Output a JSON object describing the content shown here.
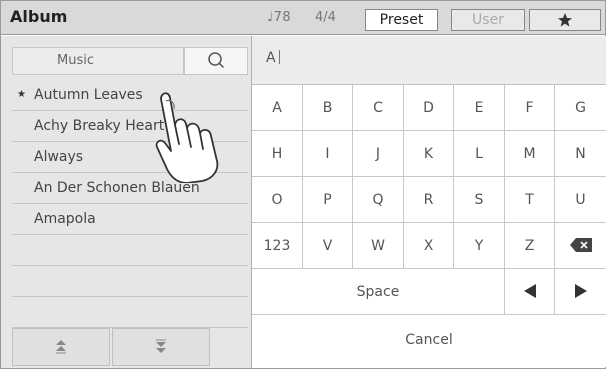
{
  "header": {
    "title": "Album",
    "tempo": "♩78",
    "time_signature": "4/4",
    "tabs": [
      {
        "label": "Preset",
        "active": true
      },
      {
        "label": "User",
        "active": false
      }
    ],
    "favorite_icon": "star-icon"
  },
  "search": {
    "label": "Music",
    "icon": "search-icon"
  },
  "songs": [
    {
      "title": "Autumn Leaves",
      "favorite": true
    },
    {
      "title": "Achy Breaky Heart",
      "favorite": false
    },
    {
      "title": "Always",
      "favorite": false
    },
    {
      "title": "An Der Schonen Blauen",
      "favorite": false
    },
    {
      "title": "Amapola",
      "favorite": false
    },
    {
      "title": "",
      "favorite": false
    },
    {
      "title": "",
      "favorite": false
    },
    {
      "title": "",
      "favorite": false
    }
  ],
  "paging": {
    "up_icon": "double-chevron-up-icon",
    "down_icon": "double-chevron-down-icon"
  },
  "keyboard": {
    "input_value": "A",
    "rows": [
      [
        "A",
        "B",
        "C",
        "D",
        "E",
        "F",
        "G"
      ],
      [
        "H",
        "I",
        "J",
        "K",
        "L",
        "M",
        "N"
      ],
      [
        "O",
        "P",
        "Q",
        "R",
        "S",
        "T",
        "U"
      ],
      [
        "123",
        "V",
        "W",
        "X",
        "Y",
        "Z"
      ]
    ],
    "backspace_icon": "backspace-icon",
    "space_label": "Space",
    "left_icon": "arrow-left-icon",
    "right_icon": "arrow-right-icon",
    "cancel_label": "Cancel"
  },
  "colors": {
    "header_bg": "#d9d9d9",
    "panel_bg": "#e6e6e6",
    "active_tab_bg": "#ffffff"
  }
}
